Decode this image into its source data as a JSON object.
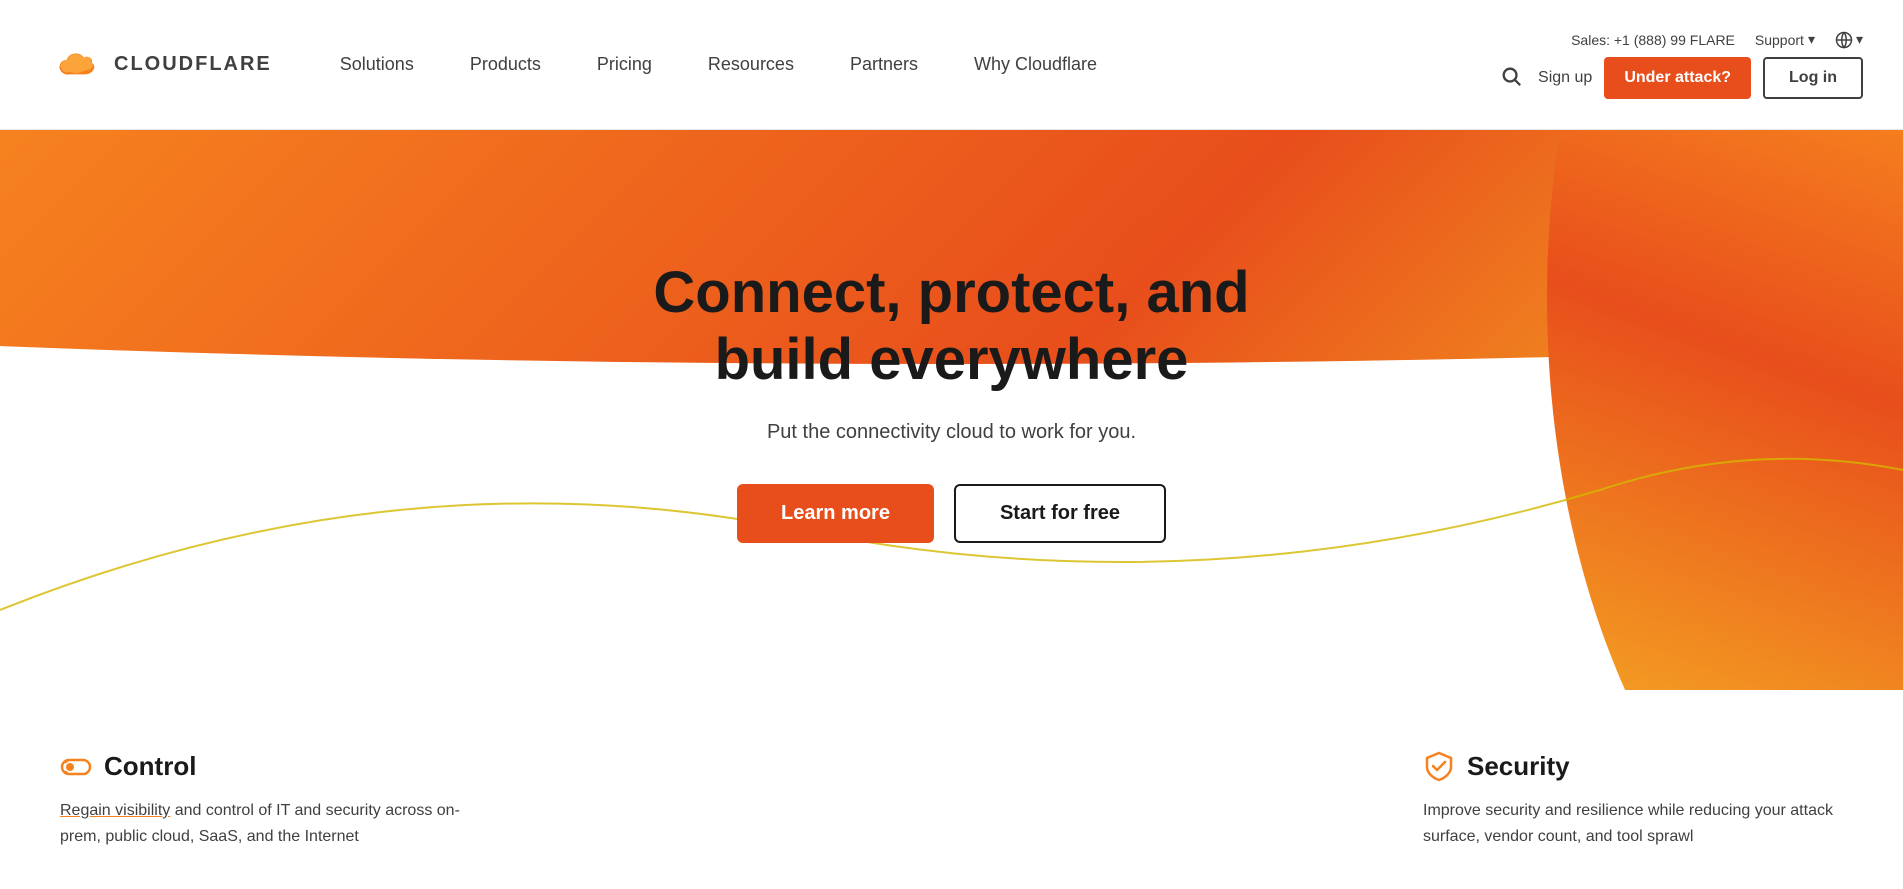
{
  "header": {
    "logo_text": "CLOUDFLARE",
    "nav_items": [
      {
        "label": "Solutions",
        "id": "solutions"
      },
      {
        "label": "Products",
        "id": "products"
      },
      {
        "label": "Pricing",
        "id": "pricing"
      },
      {
        "label": "Resources",
        "id": "resources"
      },
      {
        "label": "Partners",
        "id": "partners"
      },
      {
        "label": "Why Cloudflare",
        "id": "why-cloudflare"
      }
    ],
    "sales_text": "Sales: +1 (888) 99 FLARE",
    "support_label": "Support",
    "signup_label": "Sign up",
    "attack_label": "Under attack?",
    "login_label": "Log in"
  },
  "hero": {
    "title_line1": "Connect, protect, and",
    "title_line2": "build everywhere",
    "subtitle": "Put the connectivity cloud to work for you.",
    "learn_more_label": "Learn more",
    "start_free_label": "Start for free"
  },
  "features": [
    {
      "id": "control",
      "icon": "control-icon",
      "title": "Control",
      "text": "Regain visibility and control of IT and security across on-prem, public cloud, SaaS, and the Internet"
    },
    {
      "id": "security",
      "icon": "security-icon",
      "title": "Security",
      "text": "Improve security and resilience while reducing your attack surface, vendor count, and tool sprawl"
    }
  ],
  "icons": {
    "search": "🔍",
    "globe": "🌐",
    "chevron_down": "▾"
  },
  "colors": {
    "orange": "#f6821f",
    "red_orange": "#e84e1b",
    "dark": "#1a1a1a",
    "mid": "#404040"
  }
}
